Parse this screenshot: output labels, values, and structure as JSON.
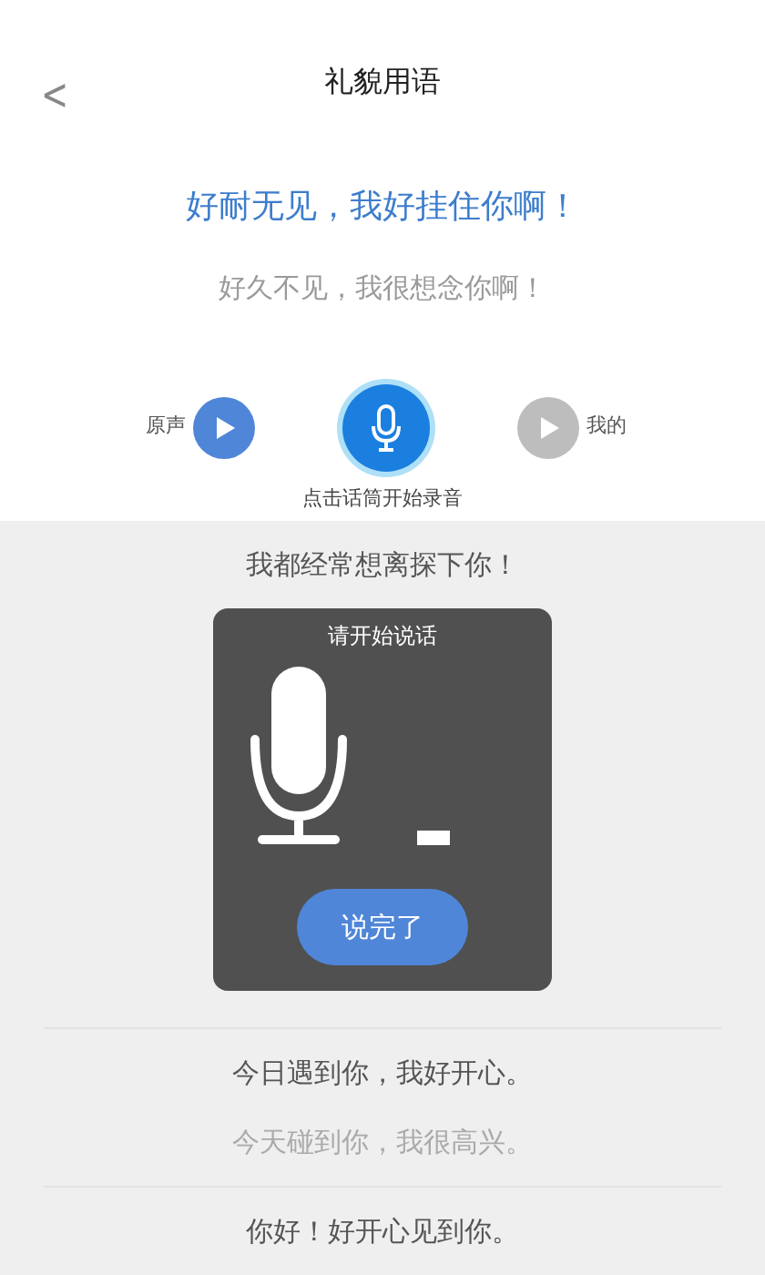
{
  "header": {
    "back": "<",
    "title": "礼貌用语"
  },
  "current": {
    "sentence": "好耐无见，我好挂住你啊！",
    "translation": "好久不见，我很想念你啊！"
  },
  "controls": {
    "original_label": "原声",
    "mine_label": "我的",
    "hint": "点击话筒开始录音"
  },
  "phrases_above": [
    {
      "lines": [
        {
          "kind": "main",
          "text": "我都经常想离探下你！"
        }
      ]
    }
  ],
  "dialog": {
    "title": "请开始说话",
    "button": "说完了"
  },
  "phrases_below": [
    {
      "lines": [
        {
          "kind": "main",
          "text": "今日遇到你，我好开心。"
        },
        {
          "kind": "sub",
          "text": "今天碰到你，我很高兴。"
        }
      ]
    },
    {
      "lines": [
        {
          "kind": "main",
          "text": "你好！好开心见到你。"
        }
      ]
    }
  ]
}
